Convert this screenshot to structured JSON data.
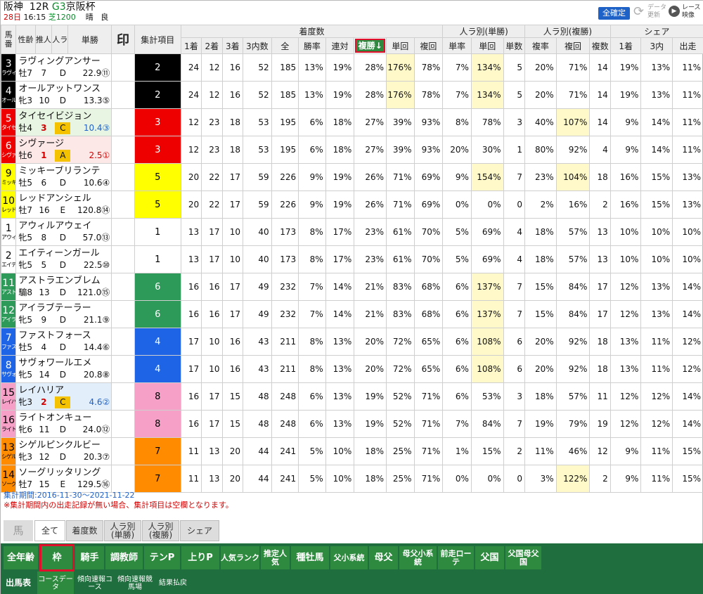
{
  "race": {
    "venue": "阪神",
    "race_no": "12R",
    "grade": "G3",
    "name": "京阪杯",
    "day": "28日",
    "time": "16:15",
    "course": "芝1200",
    "weather": "晴",
    "going": "良"
  },
  "header_buttons": {
    "confirm": "全確定",
    "update": "データ更新",
    "video": "レース映像"
  },
  "columns": {
    "umaban": "馬番",
    "age": "性齢",
    "jockey_pop": "推人",
    "rank": "人ラ",
    "odds": "単勝",
    "mark": "印",
    "item": "集計項目",
    "group_chaku": "着度数",
    "group_pop_win": "人ラ別(単勝)",
    "group_pop_place": "人ラ別(複勝)",
    "group_share": "シェア",
    "sub": [
      "1着",
      "2着",
      "3着",
      "3内数",
      "全",
      "勝率",
      "連対",
      "複勝↓",
      "単回",
      "複回",
      "単率",
      "単回",
      "単数",
      "複率",
      "複回",
      "複数",
      "1着",
      "3内",
      "出走"
    ]
  },
  "sort_column_index": 7,
  "frame_colors": {
    "1": "#ffffff",
    "2": "#000000",
    "3": "#ee0000",
    "4": "#1e64e6",
    "5": "#ffff00",
    "6": "#2e9a5a",
    "7": "#ff8c00",
    "8": "#f6a0c8"
  },
  "rows": [
    {
      "no": "3",
      "abbr": "ラヴィ",
      "name": "ラヴィングアンサー",
      "age": "牡7",
      "jockey_pop": "7",
      "rank": "D",
      "odds": "22.9⑪",
      "frame": "2",
      "marked": false,
      "rowbg": "#ffffff",
      "stats": [
        "24",
        "12",
        "16",
        "52",
        "185",
        "13%",
        "19%",
        "28%",
        "176%",
        "78%",
        "7%",
        "134%",
        "5",
        "20%",
        "71%",
        "14",
        "19%",
        "13%",
        "11%"
      ],
      "hl": [
        8,
        11
      ]
    },
    {
      "no": "4",
      "abbr": "オール",
      "name": "オールアットワンス",
      "age": "牝3",
      "jockey_pop": "10",
      "rank": "D",
      "odds": "13.3⑤",
      "frame": "2",
      "marked": false,
      "rowbg": "#ffffff",
      "stats": [
        "24",
        "12",
        "16",
        "52",
        "185",
        "13%",
        "19%",
        "28%",
        "176%",
        "78%",
        "7%",
        "134%",
        "5",
        "20%",
        "71%",
        "14",
        "19%",
        "13%",
        "11%"
      ],
      "hl": [
        8,
        11
      ]
    },
    {
      "no": "5",
      "abbr": "タイセ",
      "name": "タイセイビジョン",
      "age": "牡4",
      "jockey_pop": "3",
      "rank": "C",
      "odds": "10.4③",
      "frame": "3",
      "marked": true,
      "rowbg": "#e8f5e3",
      "stats": [
        "12",
        "23",
        "18",
        "53",
        "195",
        "6%",
        "18%",
        "27%",
        "39%",
        "93%",
        "8%",
        "78%",
        "3",
        "40%",
        "107%",
        "14",
        "9%",
        "14%",
        "11%"
      ],
      "hl": [
        14
      ]
    },
    {
      "no": "6",
      "abbr": "シヴァ",
      "name": "シヴァージ",
      "age": "牡6",
      "jockey_pop": "1",
      "rank": "A",
      "odds": "2.5①",
      "frame": "3",
      "marked": true,
      "rowbg": "#fde8e8",
      "stats": [
        "12",
        "23",
        "18",
        "53",
        "195",
        "6%",
        "18%",
        "27%",
        "39%",
        "93%",
        "20%",
        "30%",
        "1",
        "80%",
        "92%",
        "4",
        "9%",
        "14%",
        "11%"
      ],
      "hl": []
    },
    {
      "no": "9",
      "abbr": "ミッキ",
      "name": "ミッキーブリランテ",
      "age": "牡5",
      "jockey_pop": "6",
      "rank": "D",
      "odds": "10.6④",
      "frame": "5",
      "marked": false,
      "rowbg": "#ffffff",
      "stats": [
        "20",
        "22",
        "17",
        "59",
        "226",
        "9%",
        "19%",
        "26%",
        "71%",
        "69%",
        "9%",
        "154%",
        "7",
        "23%",
        "104%",
        "18",
        "16%",
        "15%",
        "13%"
      ],
      "hl": [
        11,
        14
      ]
    },
    {
      "no": "10",
      "abbr": "レッド",
      "name": "レッドアンシェル",
      "age": "牡7",
      "jockey_pop": "16",
      "rank": "E",
      "odds": "120.8⑭",
      "frame": "5",
      "marked": false,
      "rowbg": "#ffffff",
      "stats": [
        "20",
        "22",
        "17",
        "59",
        "226",
        "9%",
        "19%",
        "26%",
        "71%",
        "69%",
        "0%",
        "0%",
        "0",
        "2%",
        "16%",
        "2",
        "16%",
        "15%",
        "13%"
      ],
      "hl": []
    },
    {
      "no": "1",
      "abbr": "アウィ",
      "name": "アウィルアウェイ",
      "age": "牝5",
      "jockey_pop": "8",
      "rank": "D",
      "odds": "57.0⑬",
      "frame": "1",
      "marked": false,
      "rowbg": "#ffffff",
      "stats": [
        "13",
        "17",
        "10",
        "40",
        "173",
        "8%",
        "17%",
        "23%",
        "61%",
        "70%",
        "5%",
        "69%",
        "4",
        "18%",
        "57%",
        "13",
        "10%",
        "10%",
        "10%"
      ],
      "hl": []
    },
    {
      "no": "2",
      "abbr": "エイテ",
      "name": "エイティーンガール",
      "age": "牝5",
      "jockey_pop": "5",
      "rank": "D",
      "odds": "22.5⑩",
      "frame": "1",
      "marked": false,
      "rowbg": "#ffffff",
      "stats": [
        "13",
        "17",
        "10",
        "40",
        "173",
        "8%",
        "17%",
        "23%",
        "61%",
        "70%",
        "5%",
        "69%",
        "4",
        "18%",
        "57%",
        "13",
        "10%",
        "10%",
        "10%"
      ],
      "hl": []
    },
    {
      "no": "11",
      "abbr": "アスト",
      "name": "アストラエンブレム",
      "age": "騸8",
      "jockey_pop": "13",
      "rank": "D",
      "odds": "121.0⑮",
      "frame": "6",
      "marked": false,
      "rowbg": "#ffffff",
      "stats": [
        "16",
        "16",
        "17",
        "49",
        "232",
        "7%",
        "14%",
        "21%",
        "83%",
        "68%",
        "6%",
        "137%",
        "7",
        "15%",
        "84%",
        "17",
        "12%",
        "13%",
        "14%"
      ],
      "hl": [
        11
      ]
    },
    {
      "no": "12",
      "abbr": "アイラ",
      "name": "アイラブテーラー",
      "age": "牝5",
      "jockey_pop": "9",
      "rank": "D",
      "odds": "21.1⑨",
      "frame": "6",
      "marked": false,
      "rowbg": "#ffffff",
      "stats": [
        "16",
        "16",
        "17",
        "49",
        "232",
        "7%",
        "14%",
        "21%",
        "83%",
        "68%",
        "6%",
        "137%",
        "7",
        "15%",
        "84%",
        "17",
        "12%",
        "13%",
        "14%"
      ],
      "hl": [
        11
      ]
    },
    {
      "no": "7",
      "abbr": "ファス",
      "name": "ファストフォース",
      "age": "牡5",
      "jockey_pop": "4",
      "rank": "D",
      "odds": "14.4⑥",
      "frame": "4",
      "marked": false,
      "rowbg": "#ffffff",
      "stats": [
        "17",
        "10",
        "16",
        "43",
        "211",
        "8%",
        "13%",
        "20%",
        "72%",
        "65%",
        "6%",
        "108%",
        "6",
        "20%",
        "92%",
        "18",
        "13%",
        "11%",
        "12%"
      ],
      "hl": [
        11
      ]
    },
    {
      "no": "8",
      "abbr": "サヴォ",
      "name": "サヴォワールエメ",
      "age": "牝5",
      "jockey_pop": "14",
      "rank": "D",
      "odds": "20.8⑧",
      "frame": "4",
      "marked": false,
      "rowbg": "#ffffff",
      "stats": [
        "17",
        "10",
        "16",
        "43",
        "211",
        "8%",
        "13%",
        "20%",
        "72%",
        "65%",
        "6%",
        "108%",
        "6",
        "20%",
        "92%",
        "18",
        "13%",
        "11%",
        "12%"
      ],
      "hl": [
        11
      ]
    },
    {
      "no": "15",
      "abbr": "レイハ",
      "name": "レイハリア",
      "age": "牝3",
      "jockey_pop": "2",
      "rank": "C",
      "odds": "4.6②",
      "frame": "8",
      "marked": true,
      "rowbg": "#e3eefb",
      "stats": [
        "16",
        "17",
        "15",
        "48",
        "248",
        "6%",
        "13%",
        "19%",
        "52%",
        "71%",
        "6%",
        "53%",
        "3",
        "18%",
        "57%",
        "11",
        "12%",
        "12%",
        "14%"
      ],
      "hl": []
    },
    {
      "no": "16",
      "abbr": "ライト",
      "name": "ライトオンキュー",
      "age": "牝6",
      "jockey_pop": "11",
      "rank": "D",
      "odds": "24.0⑫",
      "frame": "8",
      "marked": false,
      "rowbg": "#ffffff",
      "stats": [
        "16",
        "17",
        "15",
        "48",
        "248",
        "6%",
        "13%",
        "19%",
        "52%",
        "71%",
        "7%",
        "84%",
        "7",
        "19%",
        "79%",
        "19",
        "12%",
        "12%",
        "14%"
      ],
      "hl": []
    },
    {
      "no": "13",
      "abbr": "シゲル",
      "name": "シゲルピンクルビー",
      "age": "牝3",
      "jockey_pop": "12",
      "rank": "D",
      "odds": "20.3⑦",
      "frame": "7",
      "marked": false,
      "rowbg": "#ffffff",
      "stats": [
        "11",
        "13",
        "20",
        "44",
        "241",
        "5%",
        "10%",
        "18%",
        "25%",
        "71%",
        "1%",
        "15%",
        "2",
        "11%",
        "46%",
        "12",
        "9%",
        "11%",
        "15%"
      ],
      "hl": []
    },
    {
      "no": "14",
      "abbr": "ソーグ",
      "name": "ソーグリッタリング",
      "age": "牡7",
      "jockey_pop": "15",
      "rank": "E",
      "odds": "129.5⑯",
      "frame": "7",
      "marked": false,
      "rowbg": "#ffffff",
      "stats": [
        "11",
        "13",
        "20",
        "44",
        "241",
        "5%",
        "10%",
        "18%",
        "25%",
        "71%",
        "0%",
        "0%",
        "0",
        "3%",
        "122%",
        "2",
        "9%",
        "11%",
        "15%"
      ],
      "hl": [
        14
      ]
    }
  ],
  "notes": {
    "period": "集計期間:2016-11-30～2021-11-22",
    "caution": "※集計期間内の出走記録が無い場合、集計項目は空欄となります。"
  },
  "subtabs": {
    "horse": "馬",
    "items": [
      "全て",
      "着度数",
      "人ラ別(単勝)",
      "人ラ別(複勝)",
      "シェア"
    ],
    "active": 0
  },
  "green_tabs": {
    "items": [
      "全年齢",
      "枠",
      "騎手",
      "調教師",
      "テンP",
      "上りP",
      "人気ランク",
      "推定人気",
      "種牡馬",
      "父小系統",
      "母父",
      "母父小系統",
      "前走ローテ",
      "父国",
      "父国母父国"
    ],
    "selected": 1
  },
  "bottom_nav": {
    "items": [
      "出馬表",
      "コースデータ",
      "傾向速報コース",
      "傾向速報競馬場",
      "結果払戻"
    ],
    "active": 1
  }
}
